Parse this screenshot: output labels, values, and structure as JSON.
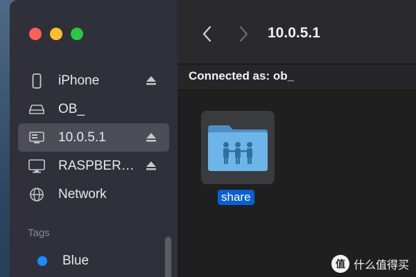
{
  "window": {
    "title": "10.0.5.1",
    "connection_status": "Connected as: ob_"
  },
  "sidebar": {
    "items": [
      {
        "label": "iPhone",
        "icon": "phone-icon",
        "ejectable": true,
        "selected": false
      },
      {
        "label": "OB_",
        "icon": "drive-icon",
        "ejectable": false,
        "selected": false
      },
      {
        "label": "10.0.5.1",
        "icon": "server-icon",
        "ejectable": true,
        "selected": true
      },
      {
        "label": "RASPBER…",
        "icon": "display-icon",
        "ejectable": true,
        "selected": false
      },
      {
        "label": "Network",
        "icon": "globe-icon",
        "ejectable": false,
        "selected": false
      }
    ],
    "tags_title": "Tags",
    "tags": [
      {
        "label": "Blue",
        "color": "#1a8cff"
      }
    ]
  },
  "content": {
    "items": [
      {
        "label": "share",
        "icon": "shared-folder-icon",
        "selected": true
      }
    ]
  },
  "watermark": {
    "badge": "值",
    "text": "什么值得买"
  },
  "colors": {
    "sidebar_bg": "#2f3039",
    "selection": "#4b4d57",
    "accent": "#0a5fd4",
    "close": "#ff5f57",
    "minimize": "#febc2e",
    "zoom": "#28c840"
  }
}
